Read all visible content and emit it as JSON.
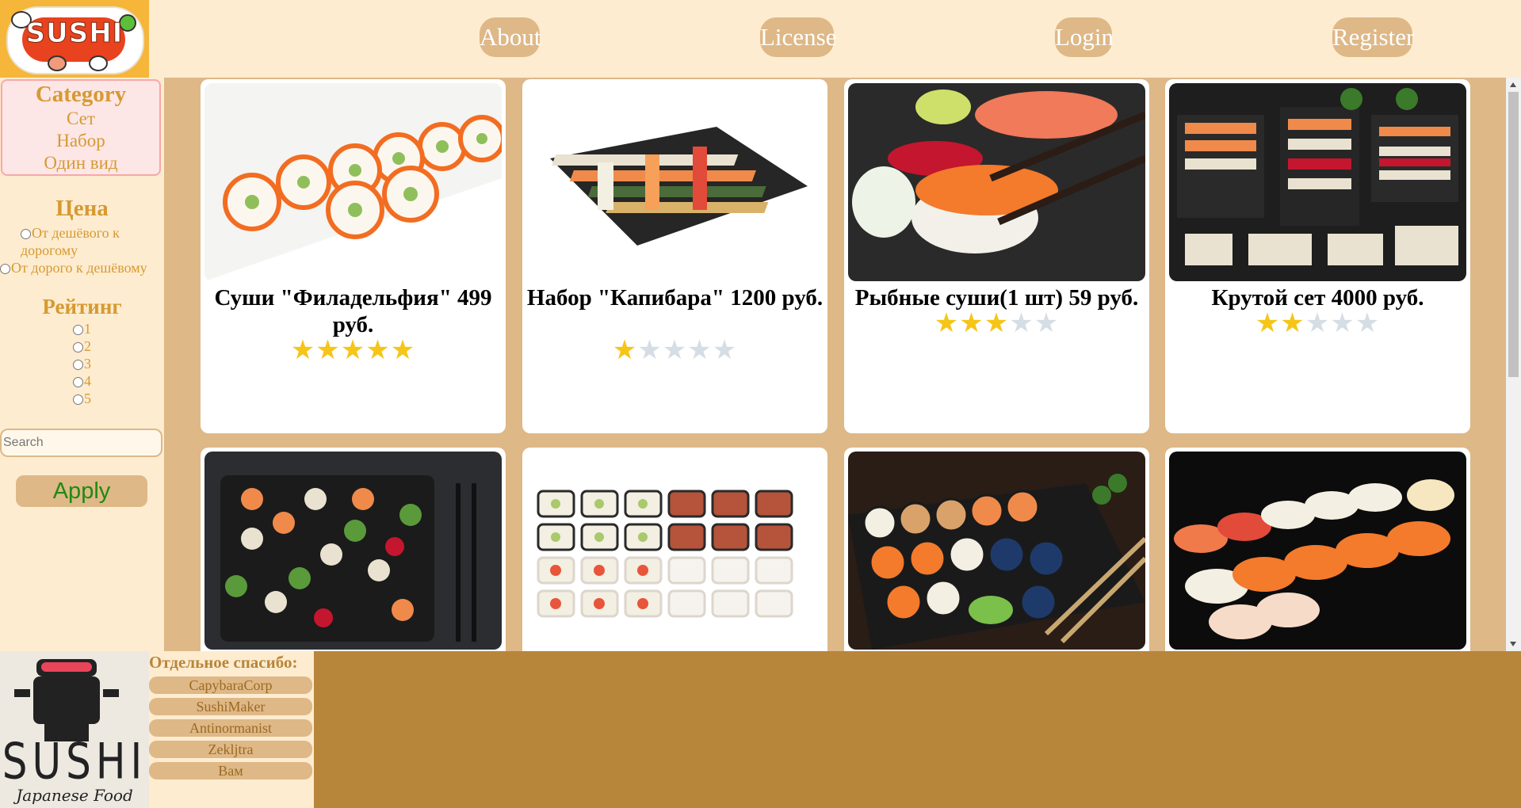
{
  "header": {
    "logo_text": "SUSHI",
    "nav": [
      "About",
      "License",
      "Login",
      "Register"
    ]
  },
  "sidebar": {
    "category_title": "Category",
    "categories": [
      "Сет",
      "Набор",
      "Один вид"
    ],
    "price_title": "Цена",
    "price_options": [
      "От дешёвого к дорогому",
      "От дорого к дешёвому"
    ],
    "rating_title": "Рейтинг",
    "rating_options": [
      "1",
      "2",
      "3",
      "4",
      "5"
    ],
    "search_placeholder": "Search",
    "apply_label": "Apply"
  },
  "products": [
    {
      "title": "Суши \"Филадельфия\" 499 руб.",
      "rating": 5,
      "image": "philadelphia-rolls"
    },
    {
      "title": "Набор \"Капибара\" 1200 руб.",
      "rating": 1,
      "image": "sushi-set-slate"
    },
    {
      "title": "Рыбные суши(1 шт) 59 руб.",
      "rating": 3,
      "image": "nigiri-chopsticks"
    },
    {
      "title": "Крутой сет 4000 руб.",
      "rating": 2,
      "image": "large-sushi-platter"
    },
    {
      "title": "",
      "rating": null,
      "image": "assorted-sushi-dark"
    },
    {
      "title": "",
      "rating": null,
      "image": "rolls-grid"
    },
    {
      "title": "",
      "rating": null,
      "image": "rolls-on-board"
    },
    {
      "title": "",
      "rating": null,
      "image": "nigiri-row"
    }
  ],
  "footer": {
    "logo_text": "SUSHI",
    "logo_subtext": "Japanese Food",
    "thanks_title": "Отдельное спасибо:",
    "thanks": [
      "CapybaraCorp",
      "SushiMaker",
      "Antinormanist",
      "Zekljtra",
      "Вам"
    ]
  },
  "colors": {
    "header_bg": "#feecd0",
    "accent": "#deb887",
    "heading": "#d59a32",
    "footer_bg": "#b8863b",
    "star": "#f5c518"
  }
}
